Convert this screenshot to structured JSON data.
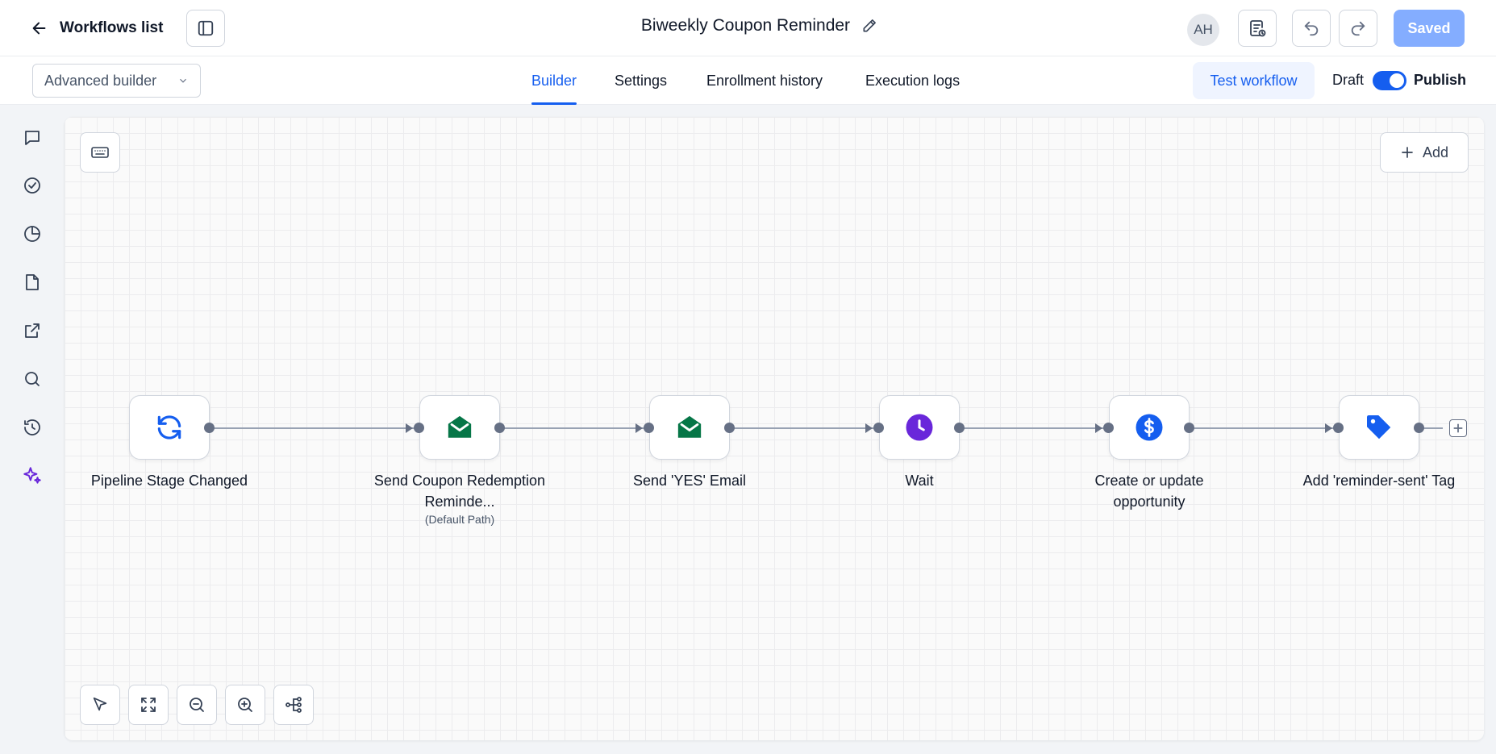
{
  "header": {
    "back_label": "Workflows list",
    "title": "Biweekly Coupon Reminder",
    "avatar_initials": "AH",
    "saved_label": "Saved"
  },
  "subbar": {
    "builder_mode": "Advanced builder",
    "tabs": [
      {
        "label": "Builder",
        "active": true
      },
      {
        "label": "Settings",
        "active": false
      },
      {
        "label": "Enrollment history",
        "active": false
      },
      {
        "label": "Execution logs",
        "active": false
      }
    ],
    "test_label": "Test workflow",
    "draft_label": "Draft",
    "publish_label": "Publish",
    "publish_on": true
  },
  "rail": [
    "chat-icon",
    "check-circle-icon",
    "pie-chart-icon",
    "file-icon",
    "external-link-icon",
    "search-icon",
    "history-icon",
    "sparkle-icon"
  ],
  "canvas": {
    "add_label": "Add",
    "nodes": [
      {
        "label": "Pipeline Stage Changed",
        "sub": "",
        "icon": "refresh-icon",
        "color": "#155eef"
      },
      {
        "label": "Send Coupon Redemption Reminde...",
        "sub": "(Default Path)",
        "icon": "email-icon",
        "color": "#067647"
      },
      {
        "label": "Send 'YES' Email",
        "sub": "",
        "icon": "email-icon",
        "color": "#067647"
      },
      {
        "label": "Wait",
        "sub": "",
        "icon": "clock-icon",
        "color": "#6927da"
      },
      {
        "label": "Create or update opportunity",
        "sub": "",
        "icon": "dollar-icon",
        "color": "#155eef"
      },
      {
        "label": "Add 'reminder-sent' Tag",
        "sub": "",
        "icon": "tag-icon",
        "color": "#155eef"
      }
    ]
  },
  "colors": {
    "accent": "#155eef",
    "saved_button": "#84adff",
    "email_green": "#067647",
    "wait_purple": "#6927da"
  }
}
